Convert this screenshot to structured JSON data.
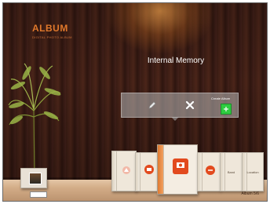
{
  "brand": {
    "title": "ALBUM",
    "subtitle": "DIGITAL PHOTO ALBUM"
  },
  "panel": {
    "title": "Internal Memory",
    "create_label": "Create Album"
  },
  "shelf": {
    "books": [
      {
        "label": ""
      },
      {
        "label": ""
      },
      {
        "label": ""
      },
      {
        "label": ""
      },
      {
        "label": "Band"
      },
      {
        "label": "Location"
      }
    ]
  },
  "status": {
    "album_count": "Album 5/6"
  },
  "colors": {
    "accent": "#e0782b",
    "create_button": "#2ecc40",
    "badge": "#e24a1e"
  },
  "icons": {
    "edit": "pencil-icon",
    "delete": "close-icon",
    "create": "plus-icon"
  }
}
